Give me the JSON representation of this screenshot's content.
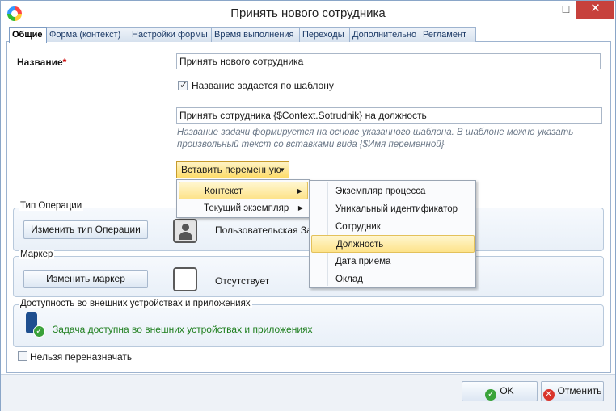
{
  "window": {
    "title": "Принять нового сотрудника",
    "min": "—",
    "max": "□",
    "close": "✕"
  },
  "tabs": [
    {
      "label": "Общие"
    },
    {
      "label": "Форма (контекст)"
    },
    {
      "label": "Настройки формы"
    },
    {
      "label": "Время выполнения"
    },
    {
      "label": "Переходы"
    },
    {
      "label": "Дополнительно"
    },
    {
      "label": "Регламент"
    }
  ],
  "general": {
    "name_label": "Название",
    "required_mark": "*",
    "name_value": "Принять нового сотрудника",
    "template_checkbox_label": "Название задается по шаблону",
    "template_checked": true,
    "template_value": "Принять сотрудника {$Context.Sotrudnik} на должность",
    "hint": "Название задачи формируется на основе указанного шаблона. В шаблоне можно указать произвольный текст со вставками вида {$Имя переменной}",
    "insert_variable_label": "Вставить переменную"
  },
  "operation_type": {
    "title": "Тип Операции",
    "change_button": "Изменить тип Операции",
    "value": "Пользовательская Задача"
  },
  "marker": {
    "title": "Маркер",
    "change_button": "Изменить маркер",
    "value": "Отсутствует"
  },
  "availability": {
    "title": "Доступность во внешних устройствах и приложениях",
    "status": "Задача доступна во внешних устройствах и приложениях"
  },
  "no_reassign": {
    "label": "Нельзя переназначать",
    "checked": false
  },
  "menu_main": [
    {
      "label": "Контекст",
      "highlighted": true
    },
    {
      "label": "Текущий экземпляр",
      "highlighted": false
    }
  ],
  "menu_sub": [
    {
      "label": "Экземпляр процесса",
      "highlighted": false
    },
    {
      "label": "Уникальный идентификатор",
      "highlighted": false
    },
    {
      "label": "Сотрудник",
      "highlighted": false
    },
    {
      "label": "Должность",
      "highlighted": true
    },
    {
      "label": "Дата приема",
      "highlighted": false
    },
    {
      "label": "Оклад",
      "highlighted": false
    }
  ],
  "footer": {
    "ok": "OK",
    "cancel": "Отменить"
  }
}
